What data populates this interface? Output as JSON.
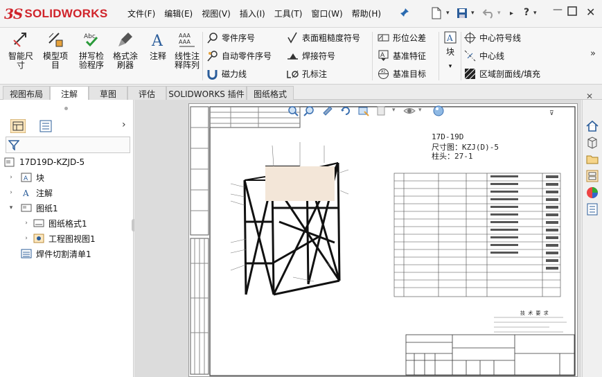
{
  "app": {
    "brand_ds": "3S",
    "brand_name": "SOLIDWORKS"
  },
  "menu": [
    "文件(F)",
    "编辑(E)",
    "视图(V)",
    "插入(I)",
    "工具(T)",
    "窗口(W)",
    "帮助(H)"
  ],
  "ribbon": {
    "big": [
      {
        "name": "smart-dimension-button",
        "label1": "智能尺",
        "label2": "寸"
      },
      {
        "name": "model-items-button",
        "label1": "模型项",
        "label2": "目"
      },
      {
        "name": "spell-checker-button",
        "label1": "拼写检",
        "label2": "验程序"
      },
      {
        "name": "format-painter-button",
        "label1": "格式涂",
        "label2": "刷器"
      },
      {
        "name": "note-button",
        "label1": "注释",
        "label2": ""
      },
      {
        "name": "linear-note-pattern-button",
        "label1": "线性注",
        "label2": "释阵列"
      }
    ],
    "col1": [
      "零件序号",
      "自动零件序号",
      "磁力线"
    ],
    "col2": [
      "表面粗糙度符号",
      "焊接符号",
      "孔标注"
    ],
    "col3": [
      "形位公差",
      "基准特征",
      "基准目标"
    ],
    "block": "块",
    "col4": [
      "中心符号线",
      "中心线",
      "区域剖面线/填充"
    ]
  },
  "tabs": [
    "视图布局",
    "注解",
    "草图",
    "评估",
    "SOLIDWORKS 插件",
    "图纸格式"
  ],
  "active_tab": "注解",
  "tree": {
    "root": "17D19D-KZJD-5",
    "items": [
      "块",
      "注解",
      "图纸1",
      "图纸格式1",
      "工程图视图1",
      "焊件切割清单1"
    ]
  },
  "drawing": {
    "line1": "17D-19D",
    "line2": "尺寸图：KZJ(D)-5",
    "line3": "柱头：27-1",
    "tech_title": "技 术 要 求"
  },
  "colors": {
    "brand": "#d0242b",
    "tab_bg": "#e4e4e4",
    "active_tab": "#ffffff"
  }
}
